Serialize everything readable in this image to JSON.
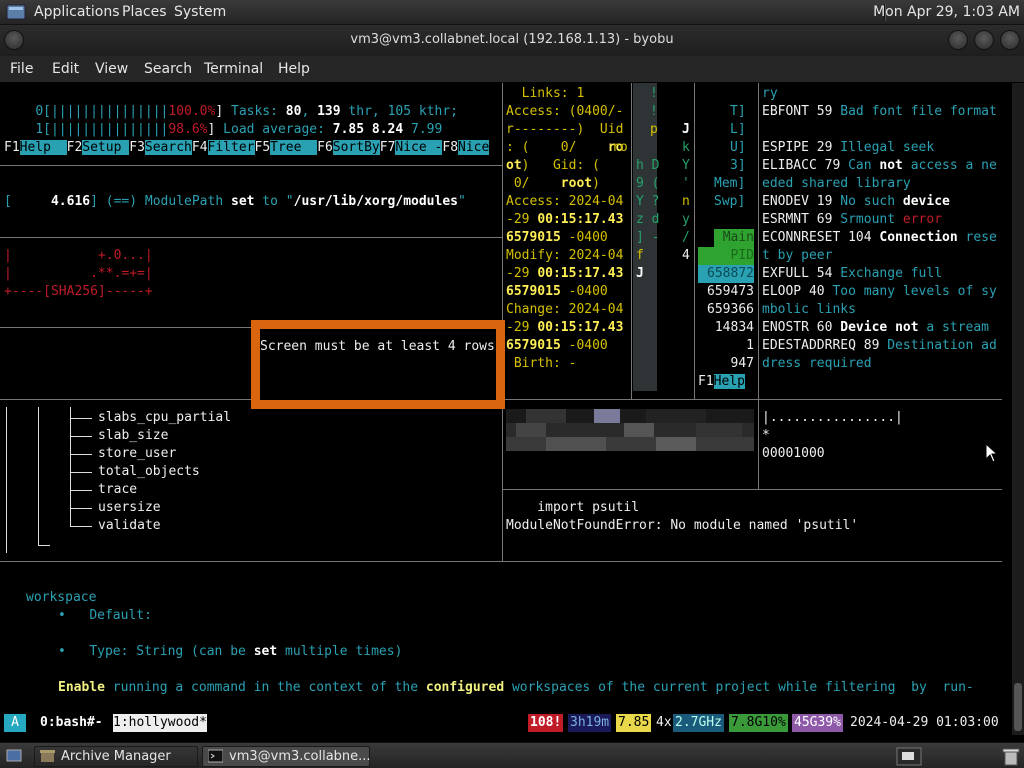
{
  "panel": {
    "applications": "Applications",
    "places": "Places",
    "system": "System",
    "clock": "Mon Apr 29, 1:03 AM"
  },
  "window": {
    "title": "vm3@vm3.collabnet.local (192.168.1.13) - byobu"
  },
  "menubar": [
    "File",
    "Edit",
    "View",
    "Search",
    "Terminal",
    "Help"
  ],
  "htop": {
    "cpu0_bar": "0[|||||||||||||||",
    "cpu0_pct": "100.0%",
    "cpu1_bar": "1[|||||||||||||||",
    "cpu1_pct": "98.6%",
    "tasks_label": "Tasks: ",
    "tasks": "80",
    "thr": "139",
    "thr_label": " thr, ",
    "kthr": "105 kthr;",
    "load_label": "Load average: ",
    "load1": "7.85",
    "load5": "8.24",
    "load15": "7.99",
    "fkeys": [
      {
        "k": "F1",
        "l": "Help  "
      },
      {
        "k": "F2",
        "l": "Setup "
      },
      {
        "k": "F3",
        "l": "Search"
      },
      {
        "k": "F4",
        "l": "Filter"
      },
      {
        "k": "F5",
        "l": "Tree  "
      },
      {
        "k": "F6",
        "l": "SortBy"
      },
      {
        "k": "F7",
        "l": "Nice -"
      },
      {
        "k": "F8",
        "l": "Nice"
      }
    ]
  },
  "xorg": {
    "time": "4.616",
    "text1": "] (==) ModulePath ",
    "set": "set",
    "to": " to \"",
    "path": "/usr/lib/xorg/modules",
    "end": "\""
  },
  "sha": {
    "l1": "|           +.0...|",
    "l2": "|          .**.=+=|",
    "l3": "+----[SHA256]-----+"
  },
  "alert": {
    "message": "Screen must be at least 4 rows"
  },
  "stat": {
    "l1": "  Links: 1",
    "l2": "Access: (0400/-",
    "l3": "r--------)  Uid",
    "l4a": ": (    0/    ",
    "l4b": "ro",
    "l5a": "ot",
    "l5b": ")   Gid: (",
    "l6a": " 0/    ",
    "l6b": "root",
    "l6c": ")",
    "l7": "Access: 2024-04",
    "l8a": "-29 ",
    "l8b": "00:15:17.43",
    "l9a": "6579015",
    "l9b": " -0400",
    "l10": "Modify: 2024-04",
    "l11a": "-29 ",
    "l11b": "00:15:17.43",
    "l12a": "6579015",
    "l12b": " -0400",
    "l13": "Change: 2024-04",
    "l14a": "-29 ",
    "l14b": "00:15:17.43",
    "l15a": "6579015",
    "l15b": " -0400",
    "l16": " Birth: -"
  },
  "col2": {
    "rows": [
      "!",
      "p",
      "ro",
      "h D",
      "9 (",
      "Y ?",
      "z d",
      "] -",
      "f",
      "J"
    ],
    "right": [
      "J",
      "k",
      "Y",
      "'",
      "n",
      "y",
      "/",
      "4"
    ]
  },
  "pids": {
    "caps": [
      "T]",
      "L]",
      "U]",
      "3]",
      "Mem]",
      "Swp]"
    ],
    "main": "Main",
    "pid": "PID",
    "list": [
      "658872",
      "659473",
      "659366",
      "14834",
      "1",
      "947"
    ],
    "f1": "F1",
    "help": "Help"
  },
  "errno": [
    {
      "parts": [
        {
          "t": "ry",
          "c": "cy"
        }
      ]
    },
    {
      "parts": [
        {
          "t": "EBFONT 59 ",
          "c": "wh"
        },
        {
          "t": "Bad font file format",
          "c": "cy"
        }
      ]
    },
    {
      "parts": []
    },
    {
      "parts": [
        {
          "t": "ESPIPE 29 ",
          "c": "wh"
        },
        {
          "t": "Illegal seek",
          "c": "cy"
        }
      ]
    },
    {
      "parts": [
        {
          "t": "ELIBACC 79 ",
          "c": "wh"
        },
        {
          "t": "Can ",
          "c": "cy"
        },
        {
          "t": "not",
          "c": "bw"
        },
        {
          "t": " access a ne",
          "c": "cy"
        }
      ]
    },
    {
      "parts": [
        {
          "t": "eded shared library",
          "c": "cy"
        }
      ]
    },
    {
      "parts": [
        {
          "t": "ENODEV 19 ",
          "c": "wh"
        },
        {
          "t": "No such ",
          "c": "cy"
        },
        {
          "t": "device",
          "c": "bw"
        }
      ]
    },
    {
      "parts": [
        {
          "t": "ESRMNT 69 ",
          "c": "wh"
        },
        {
          "t": "Srmount ",
          "c": "cy"
        },
        {
          "t": "error",
          "c": "rd"
        }
      ]
    },
    {
      "parts": [
        {
          "t": "ECONNRESET 104 ",
          "c": "wh"
        },
        {
          "t": "Connection",
          "c": "bw"
        },
        {
          "t": " rese",
          "c": "cy"
        }
      ]
    },
    {
      "parts": [
        {
          "t": "t by peer",
          "c": "cy"
        }
      ]
    },
    {
      "parts": [
        {
          "t": "EXFULL 54 ",
          "c": "wh"
        },
        {
          "t": "Exchange full",
          "c": "cy"
        }
      ]
    },
    {
      "parts": [
        {
          "t": "ELOOP 40 ",
          "c": "wh"
        },
        {
          "t": "Too many levels of sy",
          "c": "cy"
        }
      ]
    },
    {
      "parts": [
        {
          "t": "mbolic links",
          "c": "cy"
        }
      ]
    },
    {
      "parts": [
        {
          "t": "ENOSTR 60 ",
          "c": "wh"
        },
        {
          "t": "Device",
          "c": "bw"
        },
        {
          "t": " ",
          "c": "cy"
        },
        {
          "t": "not",
          "c": "bw"
        },
        {
          "t": " a stream",
          "c": "cy"
        }
      ]
    },
    {
      "parts": [
        {
          "t": "EDESTADDRREQ 89 ",
          "c": "wh"
        },
        {
          "t": "Destination ad",
          "c": "cy"
        }
      ]
    },
    {
      "parts": [
        {
          "t": "dress required",
          "c": "cy"
        }
      ]
    }
  ],
  "tree": [
    "slabs_cpu_partial",
    "slab_size",
    "store_user",
    "total_objects",
    "trace",
    "usersize",
    "validate"
  ],
  "hexdump": {
    "l1": "|................|",
    "l2": "*",
    "l3": "00001000"
  },
  "python": {
    "l1": "    import psutil",
    "l2": "ModuleNotFoundError: No module named 'psutil'"
  },
  "help": {
    "word": "workspace",
    "default": "Default:",
    "type_a": "Type: String (can be ",
    "type_set": "set",
    "type_b": " multiple times)",
    "enable": "Enable",
    "desc_a": " running a command in the context of the ",
    "configured": "configured",
    "desc_b": " workspaces of the current project while filtering  by  run-"
  },
  "status": {
    "a": "A",
    "win0": "0:bash#-",
    "win1": "1:hollywood*",
    "updates": "108!",
    "uptime": "3h19m",
    "load": "7.85",
    "cpu_count": "4x",
    "freq": "2.7GHz",
    "mem": "7.8G10%",
    "disk": "45G39%",
    "datetime": "2024-04-29 01:03:00"
  },
  "taskbar": {
    "archive": "Archive Manager",
    "terminal": "vm3@vm3.collabne..."
  }
}
